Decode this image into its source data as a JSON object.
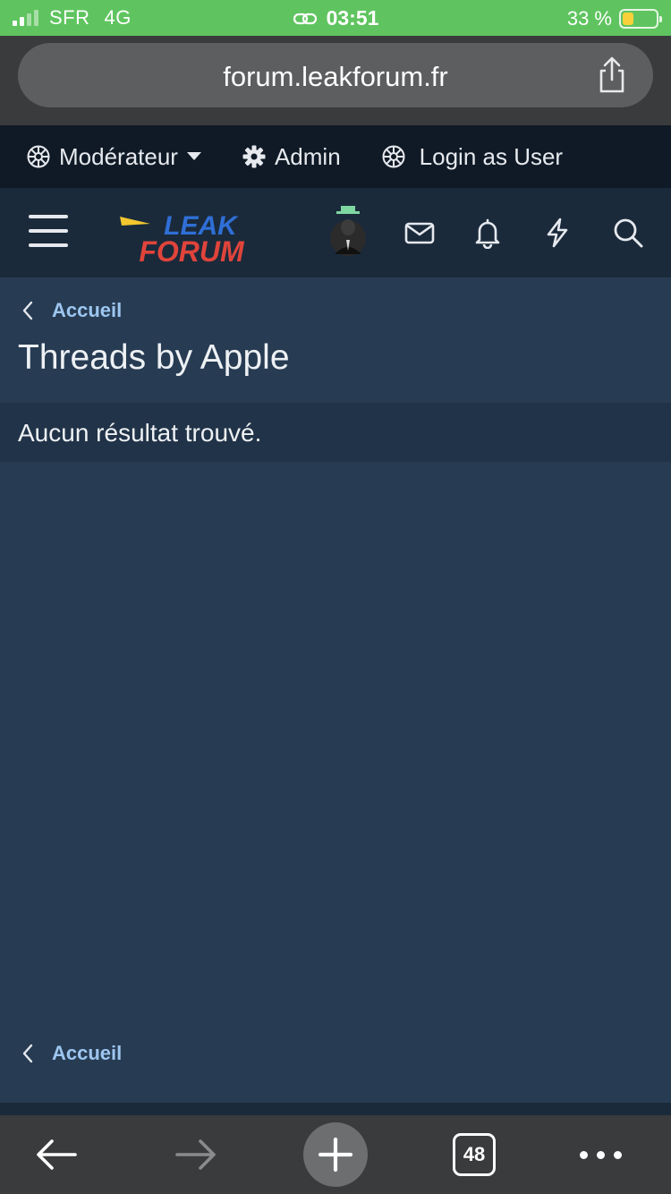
{
  "status_bar": {
    "carrier": "SFR",
    "network": "4G",
    "time": "03:51",
    "battery": "33 %",
    "battery_level": 0.33
  },
  "browser": {
    "url": "forum.leakforum.fr",
    "open_tabs": "48"
  },
  "staff_bar": {
    "moderator_label": "Modérateur",
    "admin_label": "Admin",
    "login_as_label": "Login as User"
  },
  "header": {
    "logo_top": "LEAK",
    "logo_bottom": "FORUM"
  },
  "breadcrumb": {
    "top_label": "Accueil",
    "bottom_label": "Accueil"
  },
  "page": {
    "title": "Threads by Apple",
    "empty_message": "Aucun résultat trouvé."
  },
  "colors": {
    "status_bar": "#5fc45f",
    "page_bg": "#273c53",
    "header_bg": "#1a2a3b",
    "staff_bar_bg": "#0f1a26",
    "link": "#9dc6f0",
    "logo_blue": "#2f6fd6",
    "logo_red": "#e0443b"
  }
}
